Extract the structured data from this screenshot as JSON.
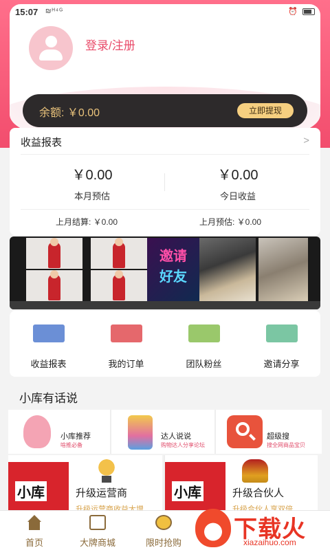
{
  "status_bar": {
    "time": "15:07",
    "signal": "₪ᴴ⁴ᴳ",
    "right": "⏰"
  },
  "profile": {
    "login_label": "登录/注册"
  },
  "balance": {
    "label": "余额: ￥0.00",
    "withdraw_button": "立即提现"
  },
  "earnings": {
    "title": "收益报表",
    "chevron": ">",
    "month_estimate": {
      "amount": "￥0.00",
      "label": "本月预估"
    },
    "today_income": {
      "amount": "￥0.00",
      "label": "今日收益"
    },
    "last_month_settled": "上月结算: ￥0.00",
    "last_month_estimate": "上月预估: ￥0.00"
  },
  "banner": {
    "line1": "邀请",
    "line2": "好友"
  },
  "quick_menu": [
    {
      "label": "收益报表",
      "icon": "report-icon",
      "color": "#6b8fd6"
    },
    {
      "label": "我的订单",
      "icon": "order-icon",
      "color": "#e5686c"
    },
    {
      "label": "团队粉丝",
      "icon": "team-icon",
      "color": "#9ac86b"
    },
    {
      "label": "邀请分享",
      "icon": "share-icon",
      "color": "#7bc6a3"
    }
  ],
  "section": {
    "title": "小库有话说",
    "tiles": [
      {
        "title": "小库推荐",
        "subtitle": "啥推必备"
      },
      {
        "title": "达人说说",
        "subtitle": "购物达人分享论坛"
      },
      {
        "title": "超级搜",
        "subtitle": "搜全网商品宝贝"
      }
    ],
    "promos": [
      {
        "brand": "小库",
        "title": "升级运营商",
        "subtitle": "升级运营商收益大增",
        "icon": "trophy-icon"
      },
      {
        "brand": "小库",
        "title": "升级合伙人",
        "subtitle": "升级合伙人享双倍",
        "icon": "crown-icon"
      }
    ]
  },
  "bottom_nav": [
    {
      "label": "首页",
      "icon": "home-icon"
    },
    {
      "label": "大牌商城",
      "icon": "mall-icon"
    },
    {
      "label": "限时抢购",
      "icon": "clock-icon"
    }
  ],
  "watermark": {
    "text": "下载火",
    "url": "xiazaihuo.com"
  }
}
